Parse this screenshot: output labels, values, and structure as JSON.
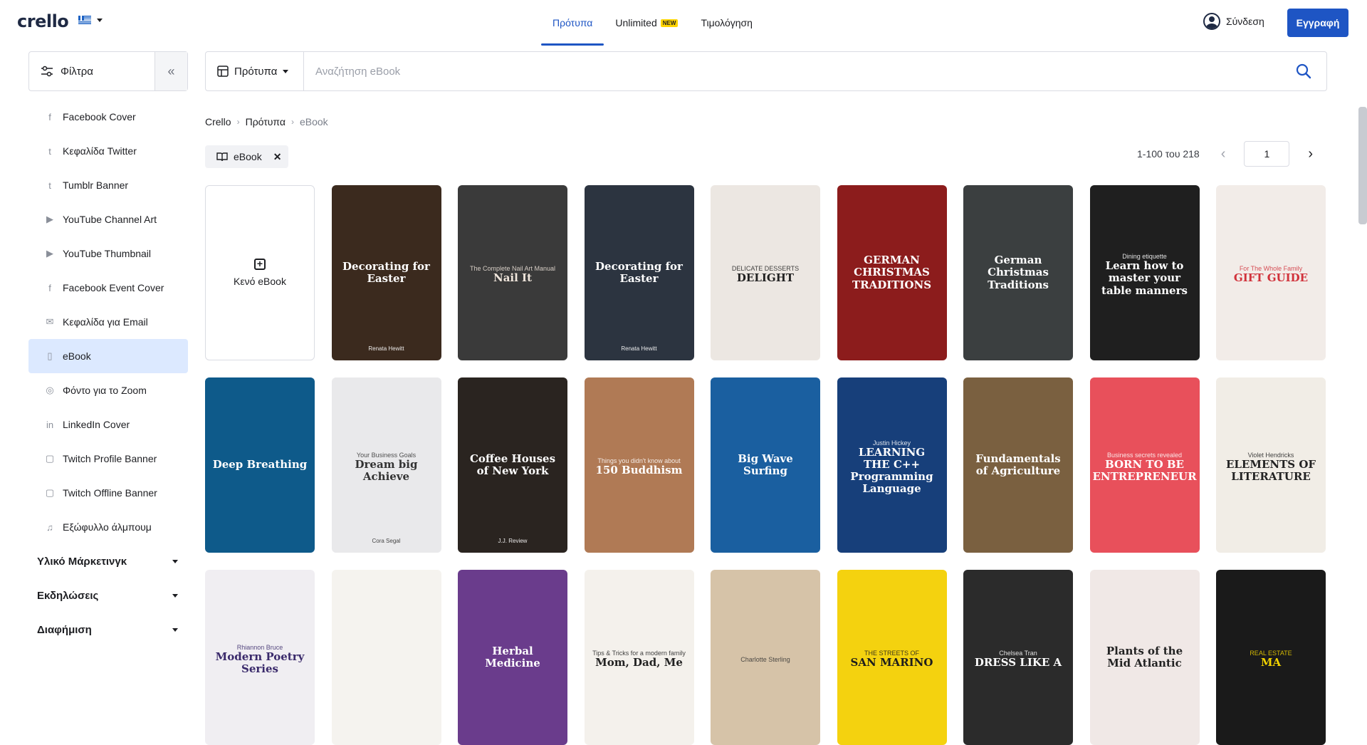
{
  "header": {
    "logo": "crello",
    "nav": [
      {
        "label": "Πρότυπα",
        "active": true
      },
      {
        "label": "Unlimited",
        "badge": "NEW"
      },
      {
        "label": "Τιμολόγηση"
      }
    ],
    "login_label": "Σύνδεση",
    "signup_label": "Εγγραφή"
  },
  "filters": {
    "label": "Φίλτρα",
    "collapse": "«"
  },
  "sidebar": {
    "items": [
      {
        "label": "Facebook Cover",
        "icon": "facebook-icon"
      },
      {
        "label": "Κεφαλίδα Twitter",
        "icon": "twitter-icon"
      },
      {
        "label": "Tumblr Banner",
        "icon": "tumblr-icon"
      },
      {
        "label": "YouTube Channel Art",
        "icon": "youtube-icon"
      },
      {
        "label": "YouTube Thumbnail",
        "icon": "youtube-icon"
      },
      {
        "label": "Facebook Event Cover",
        "icon": "facebook-icon"
      },
      {
        "label": "Κεφαλίδα για Email",
        "icon": "mail-icon"
      },
      {
        "label": "eBook",
        "icon": "book-icon",
        "active": true
      },
      {
        "label": "Φόντο για το Zoom",
        "icon": "zoom-icon"
      },
      {
        "label": "LinkedIn Cover",
        "icon": "linkedin-icon"
      },
      {
        "label": "Twitch Profile Banner",
        "icon": "twitch-icon"
      },
      {
        "label": "Twitch Offline Banner",
        "icon": "twitch-icon"
      },
      {
        "label": "Εξώφυλλο άλμπουμ",
        "icon": "album-icon"
      }
    ],
    "sections": [
      {
        "label": "Υλικό Μάρκετινγκ"
      },
      {
        "label": "Εκδηλώσεις"
      },
      {
        "label": "Διαφήμιση"
      }
    ]
  },
  "search": {
    "type_label": "Πρότυπα",
    "placeholder": "Αναζήτηση eBook"
  },
  "breadcrumb": [
    "Crello",
    "Πρότυπα",
    "eBook"
  ],
  "tag": {
    "label": "eBook"
  },
  "pager": {
    "info": "1-100 του 218",
    "page": "1"
  },
  "blank_card": {
    "label": "Κενό eBook"
  },
  "cards": [
    {
      "title": "Decorating for Easter",
      "sub": "",
      "author": "Renata Hewitt",
      "bg": "#3b2a1e",
      "fg": "#ffffff"
    },
    {
      "title": "Nail It",
      "sub": "The Complete Nail Art Manual",
      "author": "",
      "bg": "#3a3a3a",
      "fg": "#f0e6dc"
    },
    {
      "title": "Decorating for Easter",
      "sub": "",
      "author": "Renata Hewitt",
      "bg": "#2c3440",
      "fg": "#ffffff"
    },
    {
      "title": "DELIGHT",
      "sub": "DELICATE DESSERTS",
      "author": "",
      "bg": "#ece7e2",
      "fg": "#222222"
    },
    {
      "title": "GERMAN CHRISTMAS TRADITIONS",
      "sub": "",
      "author": "",
      "bg": "#8c1c1c",
      "fg": "#ffffff"
    },
    {
      "title": "German Christmas Traditions",
      "sub": "",
      "author": "",
      "bg": "#3b3f40",
      "fg": "#ffffff"
    },
    {
      "title": "Learn how to master your table manners",
      "sub": "Dining etiquette",
      "author": "",
      "bg": "#1f1f1f",
      "fg": "#ffffff"
    },
    {
      "title": "GIFT GUIDE",
      "sub": "For The Whole Family",
      "author": "",
      "bg": "#f2ece8",
      "fg": "#d1323b"
    },
    {
      "title": "Deep Breathing",
      "sub": "",
      "author": "",
      "bg": "#0e5a8a",
      "fg": "#ffffff"
    },
    {
      "title": "Dream big Achieve",
      "sub": "Your Business Goals",
      "author": "Cora Segal",
      "bg": "#e9e9eb",
      "fg": "#333333"
    },
    {
      "title": "Coffee Houses of New York",
      "sub": "",
      "author": "J.J. Review",
      "bg": "#2a2420",
      "fg": "#ffffff"
    },
    {
      "title": "150 Buddhism",
      "sub": "Things you didn't know about",
      "author": "",
      "bg": "#b07a55",
      "fg": "#ffffff"
    },
    {
      "title": "Big Wave Surfing",
      "sub": "",
      "author": "",
      "bg": "#1a5fa0",
      "fg": "#ffffff"
    },
    {
      "title": "LEARNING THE C++ Programming Language",
      "sub": "Justin Hickey",
      "author": "",
      "bg": "#173f7a",
      "fg": "#ffffff"
    },
    {
      "title": "Fundamentals of Agriculture",
      "sub": "",
      "author": "",
      "bg": "#7a6040",
      "fg": "#ffffff"
    },
    {
      "title": "BORN TO BE ENTREPRENEUR",
      "sub": "Business secrets revealed",
      "author": "",
      "bg": "#e8505b",
      "fg": "#ffffff"
    },
    {
      "title": "ELEMENTS OF LITERATURE",
      "sub": "Violet Hendricks",
      "author": "",
      "bg": "#f1ede6",
      "fg": "#222222"
    },
    {
      "title": "Modern Poetry Series",
      "sub": "Rhiannon Bruce",
      "author": "",
      "bg": "#f0eef2",
      "fg": "#3a2a6b"
    },
    {
      "title": "",
      "sub": "",
      "author": "",
      "bg": "#f5f3ef",
      "fg": "#333333"
    },
    {
      "title": "Herbal Medicine",
      "sub": "",
      "author": "",
      "bg": "#6a3c8c",
      "fg": "#ffffff"
    },
    {
      "title": "Mom, Dad, Me",
      "sub": "Tips & Tricks for a modern family",
      "author": "",
      "bg": "#f4f1ec",
      "fg": "#222222"
    },
    {
      "title": "",
      "sub": "Charlotte Sterling",
      "author": "",
      "bg": "#d6c3a8",
      "fg": "#333333"
    },
    {
      "title": "SAN MARINO",
      "sub": "THE STREETS OF",
      "author": "",
      "bg": "#f4d20f",
      "fg": "#1d1d1d"
    },
    {
      "title": "DRESS LIKE A",
      "sub": "Chelsea Tran",
      "author": "",
      "bg": "#2b2b2b",
      "fg": "#ffffff"
    },
    {
      "title": "Plants of the Mid Atlantic",
      "sub": "",
      "author": "",
      "bg": "#f0e8e6",
      "fg": "#222222"
    },
    {
      "title": "MA",
      "sub": "REAL ESTATE",
      "author": "",
      "bg": "#1a1a1a",
      "fg": "#f1d200"
    }
  ]
}
